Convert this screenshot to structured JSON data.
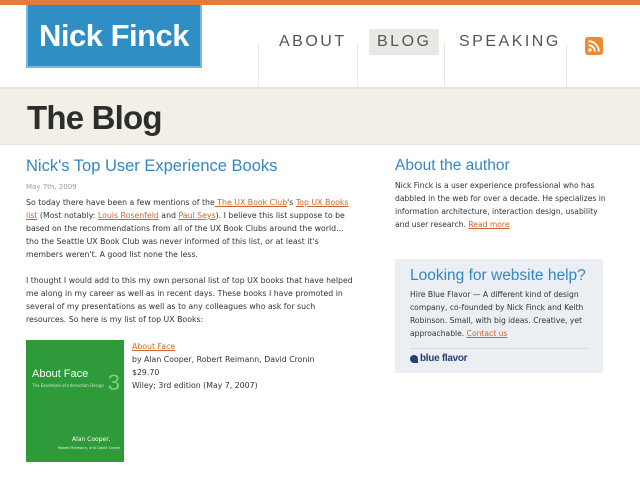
{
  "header": {
    "logo_text": "Nick Finck",
    "nav": [
      {
        "label": "ABOUT"
      },
      {
        "label": "BLOG"
      },
      {
        "label": "SPEAKING"
      }
    ],
    "rss_icon": "rss-feed-icon"
  },
  "band": {
    "title": "The Blog"
  },
  "post": {
    "title": "Nick's Top User Experience Books",
    "date": "May 7th, 2009",
    "p1": {
      "t1": "So today there have been a few mentions of the",
      "link1": " The UX Book Club",
      "t2": "'s ",
      "link2": "Top UX Books list",
      "t3": " (Most notably: ",
      "link3": "Louis Rosenfeld",
      "t4": " and ",
      "link4": "Paul Seys",
      "t5": ").  I believe this list suppose to be based on the recommendations from all of the UX Book Clubs around the world... tho the Seattle UX Book Club was never informed of this list, or at least it's members weren't. A good list none the less."
    },
    "p2": "I thought I would add to this my own personal list of top UX books that have helped me along in my career as well as in recent days.  These books I have promoted in several of my presentations as well as to any colleagues who ask for such resources. So here is my list of top UX Books:",
    "book": {
      "title": "About Face",
      "authors": "by Alan Cooper, Robert Reimann, David Cronin",
      "price": "$29.70",
      "edition": "Wiley; 3rd edition (May 7, 2007)",
      "cover": {
        "title": "About Face",
        "number": "3",
        "subtitle": "The Essentials of Interaction Design",
        "author_main": "Alan Cooper,",
        "author_rest": "Robert Reimann, and David Cronin"
      }
    }
  },
  "sidebar": {
    "about_title": "About the author",
    "about_text": "Nick Finck is a user experience professional who has dabbled in the web for over a decade. He specializes in information architecture, interaction design, usability and user research.",
    "about_link": "Read more",
    "help_title": "Looking for website help?",
    "help_text": "Hire Blue Flavor — A different kind of design company, co-founded by Nick Finck and Keith Robinson. Small, with big ideas. Creative, yet approachable.",
    "help_link": "Contact us",
    "help_logo": "blue flavor"
  },
  "colors": {
    "accent_orange": "#e37b3a",
    "logo_blue": "#2f8fc4",
    "heading_blue": "#3487c4",
    "link_orange": "#d0642b",
    "band_bg": "#f1efe6",
    "book_cover_green": "#2f9a3a"
  }
}
